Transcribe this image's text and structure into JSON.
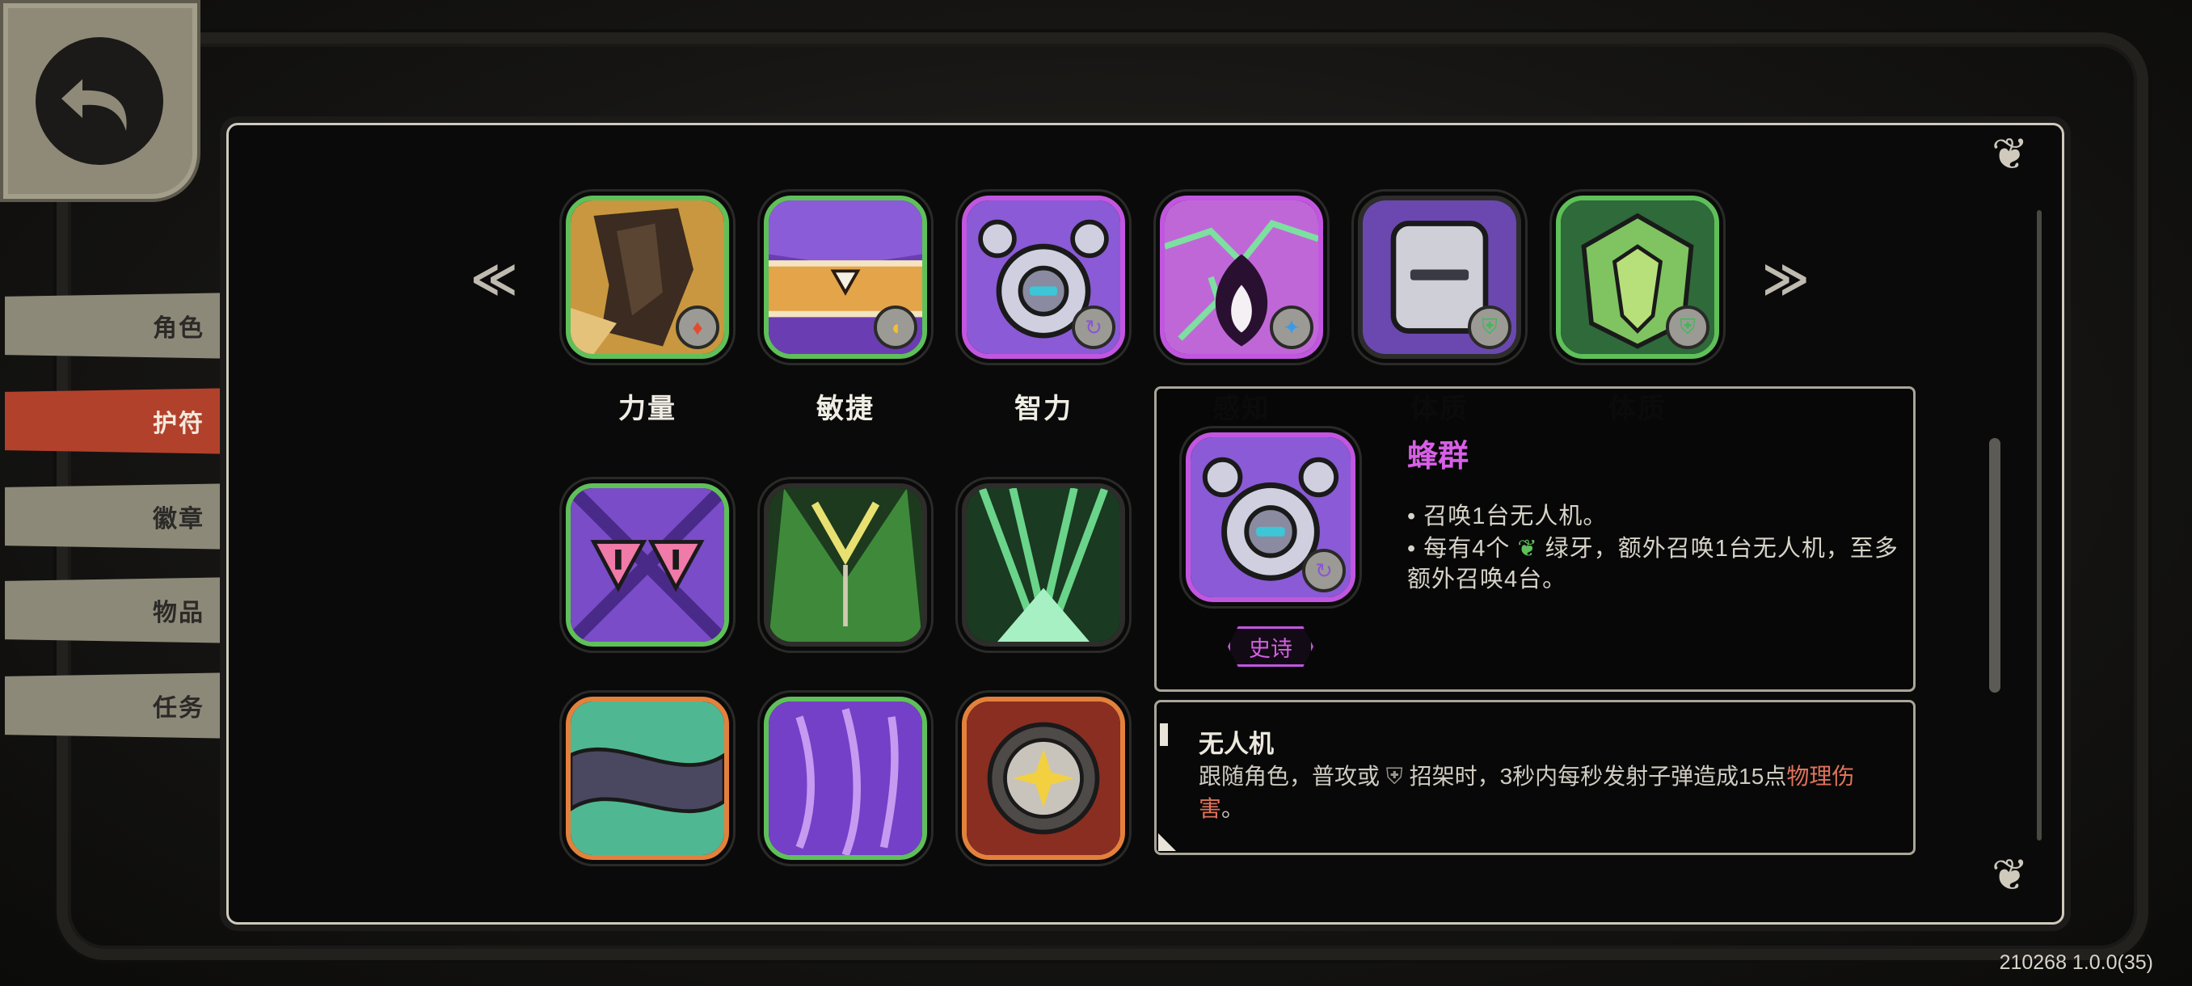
{
  "sidebar": {
    "tabs": [
      {
        "label": "角色"
      },
      {
        "label": "护符",
        "active": true
      },
      {
        "label": "徽章"
      },
      {
        "label": "物品"
      },
      {
        "label": "任务"
      }
    ]
  },
  "charms": {
    "row1_labels": [
      "力量",
      "敏捷",
      "智力",
      "感知",
      "体质",
      "体质"
    ]
  },
  "tooltip": {
    "title": "蜂群",
    "line1": "• 召唤1台无人机。",
    "line2_pre": "• 每有4个",
    "line2_post": "绿牙，额外召唤1台无人机，至多",
    "line3": "额外召唤4台。",
    "rarity": "史诗"
  },
  "subtip": {
    "name": "无人机",
    "desc_a": "跟随角色，普攻或",
    "desc_b": "招架时，3秒内每秒发射子弹造成15点",
    "desc_hl1": "物理",
    "desc_hl2": "伤害",
    "desc_end": "。"
  },
  "footer": {
    "version": "210268 1.0.0(35)"
  },
  "colors": {
    "green_rarity": "#5fc05a",
    "epic_rarity": "#c256e0",
    "orange_rarity": "#e3813c",
    "active_tab": "#b2412c",
    "highlight_text": "#e0725a"
  }
}
